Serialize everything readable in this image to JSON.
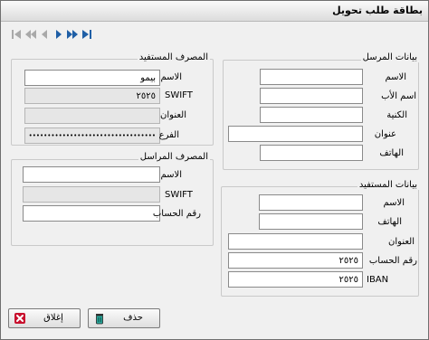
{
  "window": {
    "title": "بطاقة طلب تحويل"
  },
  "nav": {
    "first_icon": "first-record-icon",
    "prev_page_icon": "rewind-icon",
    "prev_icon": "previous-record-icon",
    "next_icon": "next-record-icon",
    "next_page_icon": "fast-forward-icon",
    "last_icon": "last-record-icon"
  },
  "beneficiary_bank": {
    "legend": "المصرف المستفيد",
    "name_label": "الاسم",
    "name_value": "بيمو",
    "swift_label": "SWIFT",
    "swift_value": "٢٥٢٥",
    "address_label": "العنوان",
    "address_value": "",
    "branch_label": "الفرع",
    "branch_value": "••••••••••••••••••••••••••••••••••••••"
  },
  "correspondent_bank": {
    "legend": "المصرف المراسل",
    "name_label": "الاسم",
    "name_value": "",
    "swift_label": "SWIFT",
    "swift_value": "",
    "account_label": "رقم الحساب",
    "account_value": ""
  },
  "sender": {
    "legend": "بيانات المرسل",
    "name_label": "الاسم",
    "name_value": "",
    "father_label": "اسم الأب",
    "father_value": "",
    "surname_label": "الكنية",
    "surname_value": "",
    "address_label": "عنوان",
    "address_value": "",
    "phone_label": "الهاتف",
    "phone_value": ""
  },
  "beneficiary": {
    "legend": "بيانات المستفيد",
    "name_label": "الاسم",
    "name_value": "",
    "phone_label": "الهاتف",
    "phone_value": "",
    "address_label": "العنوان",
    "address_value": "",
    "account_label": "رقم الحساب",
    "account_value": "٢٥٢٥",
    "iban_label": "IBAN",
    "iban_value": "٢٥٢٥"
  },
  "buttons": {
    "close_label": "إغلاق",
    "close_icon": "close-x-icon",
    "delete_label": "حذف",
    "delete_icon": "trash-icon"
  },
  "colors": {
    "nav_gray": "#a9a9a9",
    "nav_active": "#1f5fa6",
    "close_red": "#c8102e",
    "trash_teal": "#2aa69a"
  }
}
